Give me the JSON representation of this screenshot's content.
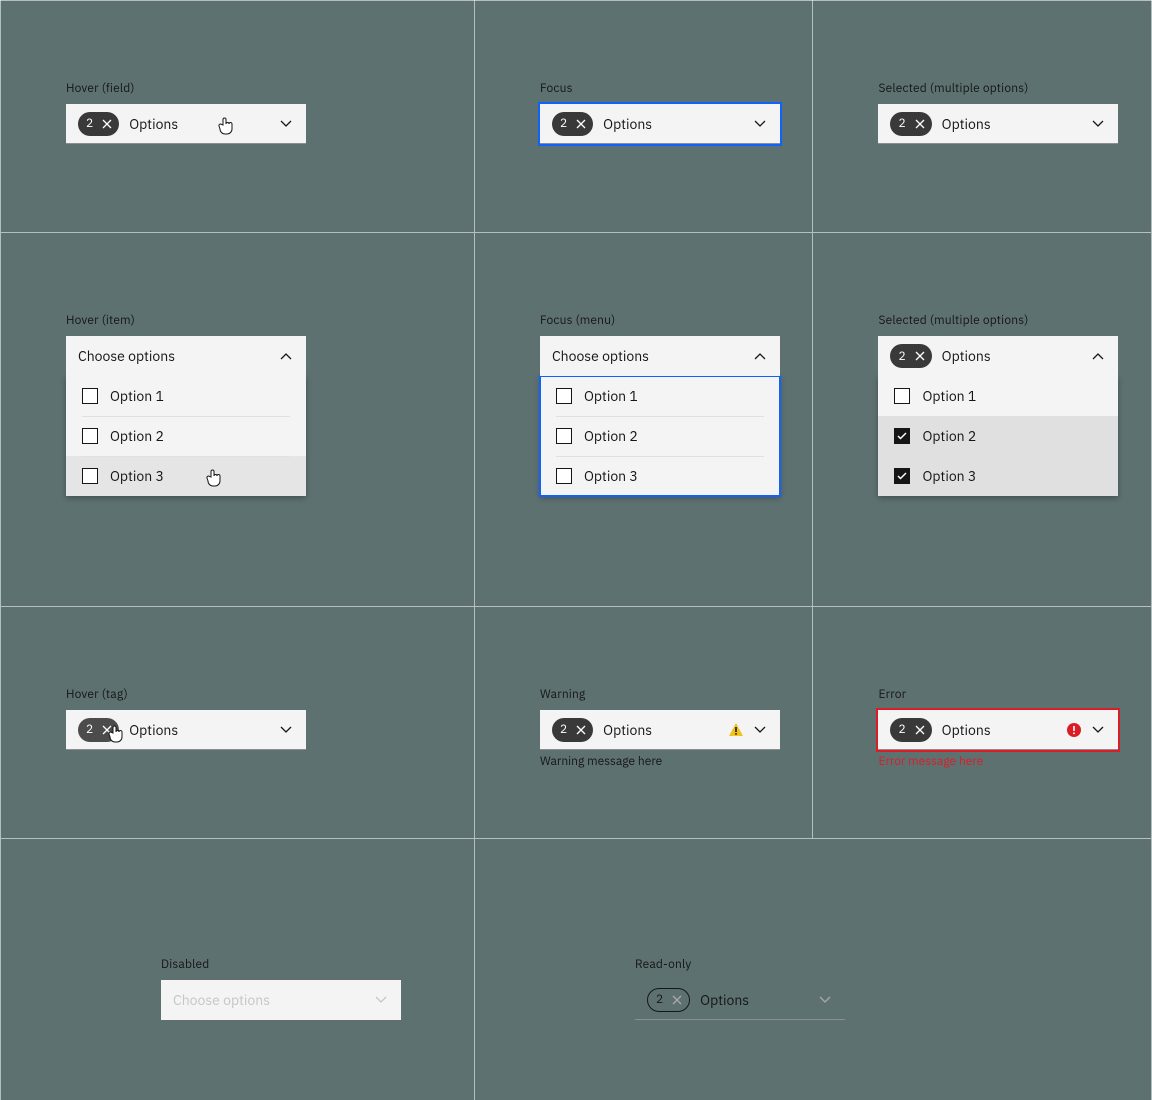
{
  "labels": {
    "hover_field": "Hover (field)",
    "focus": "Focus",
    "selected": "Selected (multiple options)",
    "hover_item": "Hover (item)",
    "focus_menu": "Focus (menu)",
    "selected_open": "Selected (multiple options)",
    "hover_tag": "Hover (tag)",
    "warning": "Warning",
    "error": "Error",
    "disabled": "Disabled",
    "readonly": "Read-only"
  },
  "field": {
    "placeholder": "Choose options",
    "value_text": "Options",
    "tag_count": "2"
  },
  "menu": {
    "items": [
      "Option 1",
      "Option 2",
      "Option 3"
    ]
  },
  "messages": {
    "warning": "Warning message here",
    "error": "Error message here"
  }
}
